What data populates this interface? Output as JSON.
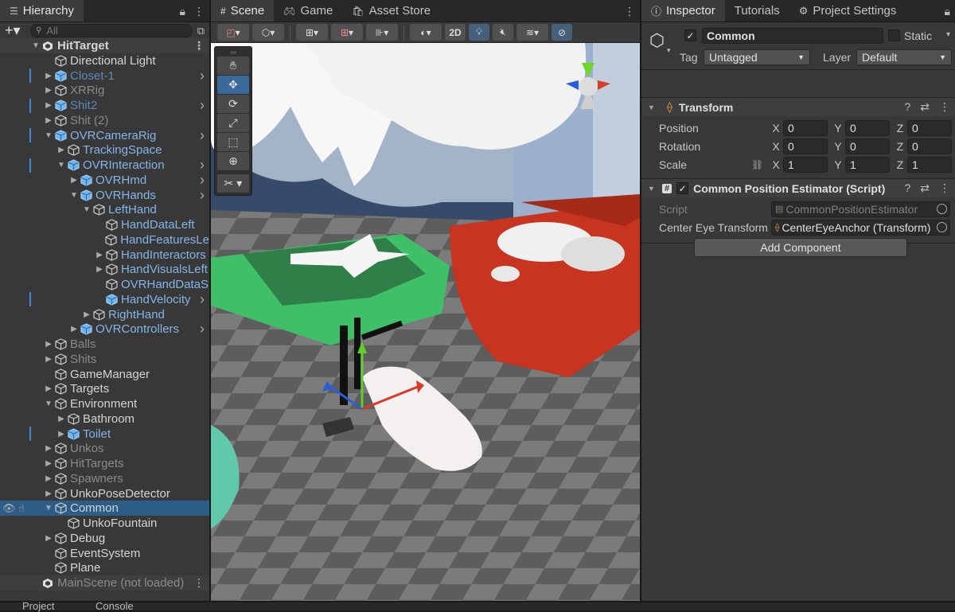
{
  "hierarchy": {
    "tab_label": "Hierarchy",
    "search_placeholder": "All",
    "rows": [
      {
        "label": "HitTarget",
        "depth": 0,
        "arrow": "down",
        "style": "bold scene",
        "more": true
      },
      {
        "label": "Directional Light",
        "depth": 1,
        "arrow": "",
        "style": ""
      },
      {
        "label": "Closet-1",
        "depth": 1,
        "arrow": "right",
        "style": "blue-dim",
        "marker": true,
        "chev": true,
        "icon": "prefab"
      },
      {
        "label": "XRRig",
        "depth": 1,
        "arrow": "right",
        "style": "dim"
      },
      {
        "label": "Shit2",
        "depth": 1,
        "arrow": "right",
        "style": "blue-dim",
        "marker": true,
        "chev": true,
        "icon": "prefab"
      },
      {
        "label": "Shit (2)",
        "depth": 1,
        "arrow": "right",
        "style": "dim"
      },
      {
        "label": "OVRCameraRig",
        "depth": 1,
        "arrow": "down",
        "style": "blue",
        "marker": true,
        "chev": true,
        "icon": "prefab"
      },
      {
        "label": "TrackingSpace",
        "depth": 2,
        "arrow": "right",
        "style": "blue"
      },
      {
        "label": "OVRInteraction",
        "depth": 2,
        "arrow": "down",
        "style": "blue",
        "marker": true,
        "chev": true,
        "icon": "prefab-add"
      },
      {
        "label": "OVRHmd",
        "depth": 3,
        "arrow": "right",
        "style": "blue",
        "chev": true,
        "icon": "prefab"
      },
      {
        "label": "OVRHands",
        "depth": 3,
        "arrow": "down",
        "style": "blue",
        "chev": true,
        "icon": "prefab"
      },
      {
        "label": "LeftHand",
        "depth": 4,
        "arrow": "down",
        "style": "blue"
      },
      {
        "label": "HandDataLeft",
        "depth": 5,
        "arrow": "",
        "style": "blue"
      },
      {
        "label": "HandFeaturesLe",
        "depth": 5,
        "arrow": "",
        "style": "blue"
      },
      {
        "label": "HandInteractors",
        "depth": 5,
        "arrow": "right",
        "style": "blue"
      },
      {
        "label": "HandVisualsLeft",
        "depth": 5,
        "arrow": "right",
        "style": "blue"
      },
      {
        "label": "OVRHandDataS",
        "depth": 5,
        "arrow": "",
        "style": "blue"
      },
      {
        "label": "HandVelocity",
        "depth": 5,
        "arrow": "",
        "style": "blue",
        "marker": true,
        "chev": true,
        "icon": "prefab-add"
      },
      {
        "label": "RightHand",
        "depth": 4,
        "arrow": "right",
        "style": "blue"
      },
      {
        "label": "OVRControllers",
        "depth": 3,
        "arrow": "right",
        "style": "blue",
        "chev": true,
        "icon": "prefab"
      },
      {
        "label": "Balls",
        "depth": 1,
        "arrow": "right",
        "style": "dim"
      },
      {
        "label": "Shits",
        "depth": 1,
        "arrow": "right",
        "style": "dim"
      },
      {
        "label": "GameManager",
        "depth": 1,
        "arrow": "",
        "style": ""
      },
      {
        "label": "Targets",
        "depth": 1,
        "arrow": "right",
        "style": ""
      },
      {
        "label": "Environment",
        "depth": 1,
        "arrow": "down",
        "style": ""
      },
      {
        "label": "Bathroom",
        "depth": 2,
        "arrow": "right",
        "style": ""
      },
      {
        "label": "Toilet",
        "depth": 2,
        "arrow": "right",
        "style": "blue",
        "marker": true,
        "icon": "prefab"
      },
      {
        "label": "Unkos",
        "depth": 1,
        "arrow": "right",
        "style": "dim"
      },
      {
        "label": "HitTargets",
        "depth": 1,
        "arrow": "right",
        "style": "dim"
      },
      {
        "label": "Spawners",
        "depth": 1,
        "arrow": "right",
        "style": "dim"
      },
      {
        "label": "UnkoPoseDetector",
        "depth": 1,
        "arrow": "right",
        "style": ""
      },
      {
        "label": "Common",
        "depth": 1,
        "arrow": "down",
        "style": "selected",
        "eye": true
      },
      {
        "label": "UnkoFountain",
        "depth": 2,
        "arrow": "",
        "style": ""
      },
      {
        "label": "Debug",
        "depth": 1,
        "arrow": "right",
        "style": ""
      },
      {
        "label": "EventSystem",
        "depth": 1,
        "arrow": "",
        "style": ""
      },
      {
        "label": "Plane",
        "depth": 1,
        "arrow": "",
        "style": ""
      },
      {
        "label": "MainScene (not loaded)",
        "depth": 0,
        "arrow": "",
        "style": "dim scene",
        "more": true
      }
    ]
  },
  "scene": {
    "tabs": [
      {
        "label": "Scene",
        "icon": "grid-icon",
        "active": true
      },
      {
        "label": "Game",
        "icon": "gamepad-icon",
        "active": false
      },
      {
        "label": "Asset Store",
        "icon": "bag-icon",
        "active": false
      }
    ],
    "toolbar_2d": "2D"
  },
  "inspector": {
    "tabs": [
      {
        "label": "Inspector",
        "icon": "info-icon",
        "active": true
      },
      {
        "label": "Tutorials",
        "icon": "",
        "active": false
      },
      {
        "label": "Project Settings",
        "icon": "gear-icon",
        "active": false
      }
    ],
    "object_name": "Common",
    "static_label": "Static",
    "tag_label": "Tag",
    "tag_value": "Untagged",
    "layer_label": "Layer",
    "layer_value": "Default",
    "transform": {
      "title": "Transform",
      "position_label": "Position",
      "rotation_label": "Rotation",
      "scale_label": "Scale",
      "position": {
        "x": "0",
        "y": "0",
        "z": "0"
      },
      "rotation": {
        "x": "0",
        "y": "0",
        "z": "0"
      },
      "scale": {
        "x": "1",
        "y": "1",
        "z": "1"
      }
    },
    "script_component": {
      "title": "Common Position Estimator (Script)",
      "script_label": "Script",
      "script_value": "CommonPositionEstimator",
      "center_eye_label": "Center Eye Transform",
      "center_eye_value": "CenterEyeAnchor (Transform)"
    },
    "add_component_label": "Add Component"
  },
  "bottom_tabs": [
    "Project",
    "Console"
  ]
}
